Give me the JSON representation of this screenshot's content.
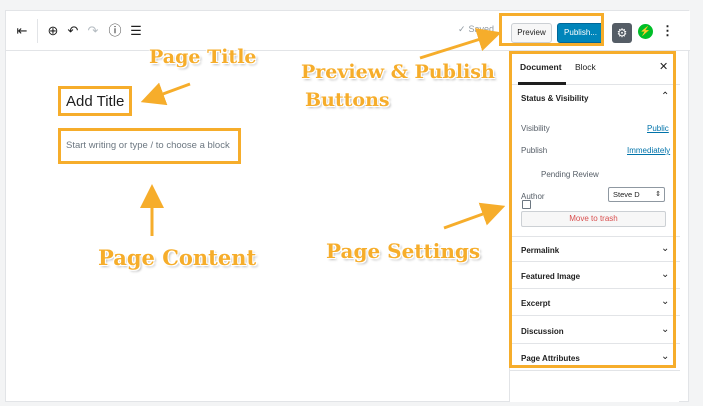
{
  "toolbar": {
    "saved_label": "Saved",
    "preview_label": "Preview",
    "publish_label": "Publish...",
    "icons": [
      "sidebar-toggle-icon",
      "add-block-icon",
      "undo-icon",
      "redo-icon",
      "info-icon",
      "list-view-icon",
      "gear-icon",
      "jetpack-icon",
      "more-icon"
    ]
  },
  "editor": {
    "title_placeholder": "Add Title",
    "content_placeholder": "Start writing or type / to choose a block"
  },
  "sidebar": {
    "tabs": [
      {
        "label": "Document",
        "active": true
      },
      {
        "label": "Block",
        "active": false
      }
    ],
    "close_label": "✕",
    "status_panel": {
      "title": "Status & Visibility",
      "visibility_label": "Visibility",
      "visibility_value": "Public",
      "publish_label": "Publish",
      "publish_value": "Immediately",
      "pending_review_label": "Pending Review",
      "pending_review_checked": false,
      "author_label": "Author",
      "author_value": "Steve D",
      "trash_label": "Move to trash"
    },
    "panels": [
      {
        "label": "Permalink"
      },
      {
        "label": "Featured Image"
      },
      {
        "label": "Excerpt"
      },
      {
        "label": "Discussion"
      },
      {
        "label": "Page Attributes"
      }
    ]
  },
  "annotations": {
    "page_title": "Page Title",
    "preview_publish_line1": "Preview & Publish",
    "preview_publish_line2": "Buttons",
    "page_content": "Page Content",
    "page_settings": "Page Settings"
  },
  "colors": {
    "annotation": "#f6ad2b",
    "publish_button": "#0085ba",
    "link": "#0073aa",
    "trash": "#d94f4f"
  }
}
